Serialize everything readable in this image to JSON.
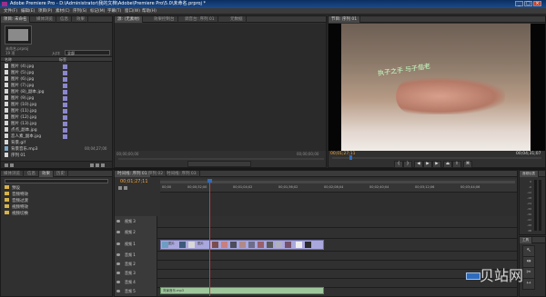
{
  "window": {
    "title": "Adobe Premiere Pro - D:\\Administrator\\我的文档\\Adobe\\Premiere Pro\\5.0\\未命名.prproj *",
    "controls": [
      "_",
      "□",
      "×"
    ]
  },
  "menu": [
    "文件(F)",
    "编辑(E)",
    "项目(P)",
    "素材(C)",
    "序列(S)",
    "标记(M)",
    "字幕(T)",
    "窗口(W)",
    "帮助(H)"
  ],
  "project_panel": {
    "tabs": [
      "项目: 未命名",
      "媒体浏览",
      "信息",
      "效果"
    ],
    "project_file": "未命名.prproj",
    "item_count": "19 项",
    "in_label": "入口:",
    "in_value": "全部",
    "col_name": "名称",
    "col_label": "标签",
    "items": [
      {
        "name": "图片 (4).jpg",
        "type": "img"
      },
      {
        "name": "图片 (5).jpg",
        "type": "img"
      },
      {
        "name": "图片 (6).jpg",
        "type": "img"
      },
      {
        "name": "图片 (7).jpg",
        "type": "img"
      },
      {
        "name": "图片 (8)_副本.jpg",
        "type": "img"
      },
      {
        "name": "图片 (9).jpg",
        "type": "img"
      },
      {
        "name": "图片 (10).jpg",
        "type": "img"
      },
      {
        "name": "图片 (11).jpg",
        "type": "img"
      },
      {
        "name": "图片 (12).jpg",
        "type": "img"
      },
      {
        "name": "图片 (13).jpg",
        "type": "img"
      },
      {
        "name": "点点_副本.jpg",
        "type": "img"
      },
      {
        "name": "恋人素_副本.jpg",
        "type": "img"
      },
      {
        "name": "背景.gif",
        "type": "img"
      },
      {
        "name": "背景音乐.mp3",
        "type": "aud"
      },
      {
        "name": "序列 01",
        "type": "img"
      }
    ],
    "duration": "00;04;27;00"
  },
  "source_panel": {
    "tabs": [
      "源: (无素材)",
      "效果控制台",
      "调音台: 序列 01",
      "元数据"
    ],
    "timecode_left": "00;00;00;00",
    "timecode_right": "00;00;00;00"
  },
  "program_panel": {
    "tab": "节目: 序列 01",
    "timecode_current": "00;01;27;11",
    "timecode_duration": "00;04;31;07",
    "overlay_text": "执子之手 与子偕老"
  },
  "bottom_left_panel": {
    "tabs": [
      "媒体浏览",
      "信息",
      "效果",
      "历史"
    ],
    "folders": [
      "预设",
      "音频特效",
      "音频过渡",
      "视频特效",
      "视频切换"
    ]
  },
  "timeline": {
    "tabs": [
      "时间线: 序列 01",
      "序列 02",
      "时间线: 序列 03"
    ],
    "timecode": "00;01;27;11",
    "ruler": [
      "00;00",
      "00;00;32;00",
      "00;01;04;02",
      "00;01;36;02",
      "00;02;08;04",
      "00;02;40;04",
      "00;03;12;06",
      "00;03;44;06"
    ],
    "video_tracks": [
      "视频 3",
      "视频 2",
      "视频 1"
    ],
    "audio_tracks": [
      "音频 1",
      "音频 2",
      "音频 3",
      "音频 4",
      "音频 5"
    ],
    "audio_clip": "背景音乐.mp3",
    "clip_labels": [
      "图片",
      "图片"
    ]
  },
  "audio_meter": {
    "tab": "音频仪表",
    "scale": [
      "0",
      "-6",
      "-12",
      "-18",
      "-24",
      "-30",
      "-36",
      "-42",
      "-48",
      "dB"
    ]
  },
  "tools_panel": {
    "tab": "工具",
    "tools": [
      "↖",
      "⇹",
      "✂",
      "⇿",
      "↔",
      "✎",
      "✋",
      "🔍"
    ]
  },
  "watermark": "贝站网",
  "colors": {
    "accent_time": "#f4a63b",
    "clip_video": "#a9a7dc",
    "clip_audio": "#9fc79c",
    "playhead": "#d23b3b"
  }
}
